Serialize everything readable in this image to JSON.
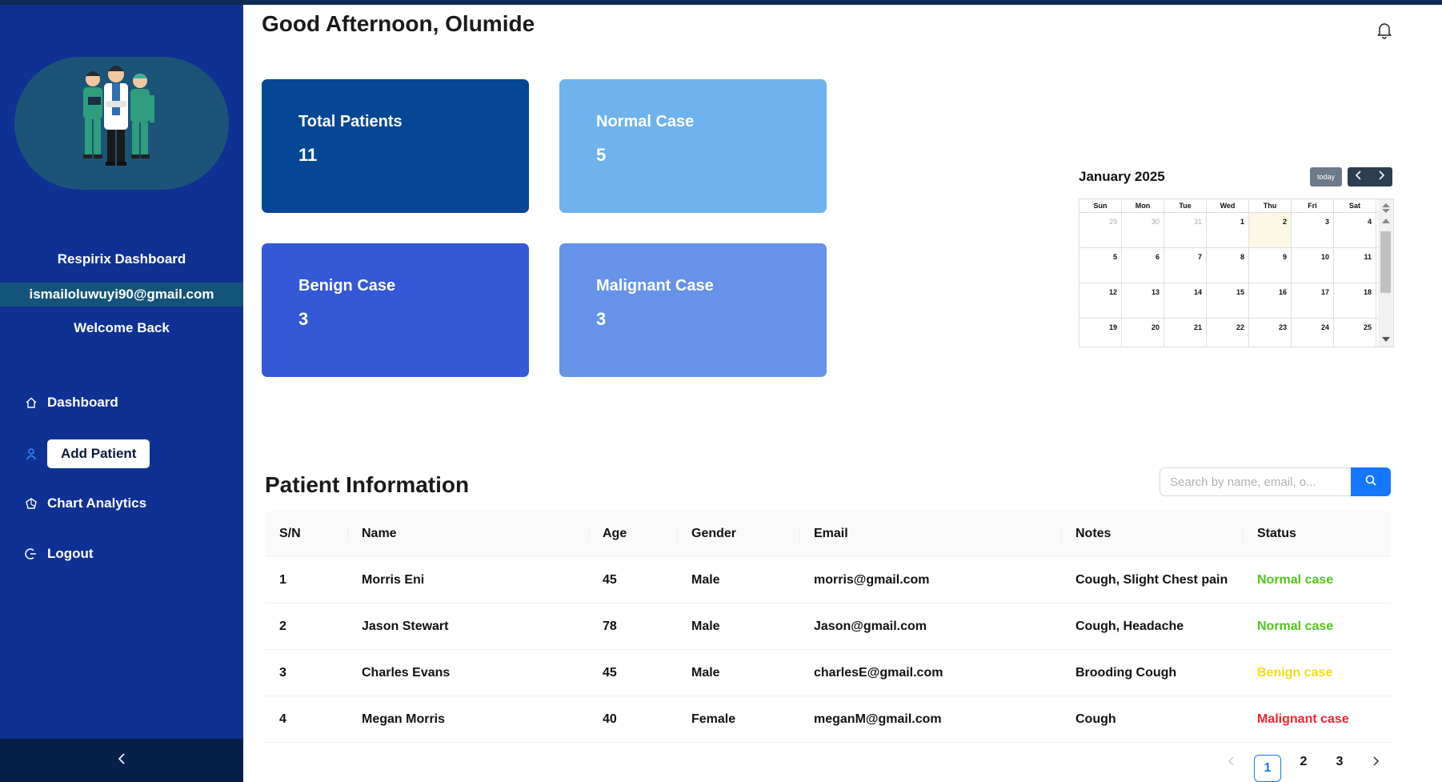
{
  "header": {
    "greeting": "Good Afternoon, Olumide"
  },
  "sidebar": {
    "app_name": "Respirix Dashboard",
    "email": "ismailoluwuyi90@gmail.com",
    "welcome": "Welcome Back",
    "nav": {
      "dashboard": "Dashboard",
      "add_patient": "Add Patient",
      "chart_analytics": "Chart Analytics",
      "logout": "Logout"
    }
  },
  "stats": {
    "total": {
      "label": "Total Patients",
      "value": "11"
    },
    "normal": {
      "label": "Normal Case",
      "value": "5"
    },
    "benign": {
      "label": "Benign Case",
      "value": "3"
    },
    "malignant": {
      "label": "Malignant Case",
      "value": "3"
    }
  },
  "calendar": {
    "title": "January 2025",
    "today_label": "today",
    "weekdays": [
      "Sun",
      "Mon",
      "Tue",
      "Wed",
      "Thu",
      "Fri",
      "Sat"
    ],
    "weeks": [
      [
        "29",
        "30",
        "31",
        "1",
        "2",
        "3",
        "4"
      ],
      [
        "5",
        "6",
        "7",
        "8",
        "9",
        "10",
        "11"
      ],
      [
        "12",
        "13",
        "14",
        "15",
        "16",
        "17",
        "18"
      ],
      [
        "19",
        "20",
        "21",
        "22",
        "23",
        "24",
        "25"
      ]
    ],
    "other_month_days": [
      "29",
      "30",
      "31"
    ],
    "today_day": "2"
  },
  "patients": {
    "title": "Patient Information",
    "search_placeholder": "Search by name, email, o...",
    "columns": [
      "S/N",
      "Name",
      "Age",
      "Gender",
      "Email",
      "Notes",
      "Status"
    ],
    "rows": [
      {
        "sn": "1",
        "name": "Morris Eni",
        "age": "45",
        "gender": "Male",
        "email": "morris@gmail.com",
        "notes": "Cough, Slight Chest pain",
        "status": "Normal case",
        "status_color": "#52c41a"
      },
      {
        "sn": "2",
        "name": "Jason Stewart",
        "age": "78",
        "gender": "Male",
        "email": "Jason@gmail.com",
        "notes": "Cough, Headache",
        "status": "Normal case",
        "status_color": "#52c41a"
      },
      {
        "sn": "3",
        "name": "Charles Evans",
        "age": "45",
        "gender": "Male",
        "email": "charlesE@gmail.com",
        "notes": "Brooding Cough",
        "status": "Benign case",
        "status_color": "#fadb14"
      },
      {
        "sn": "4",
        "name": "Megan Morris",
        "age": "40",
        "gender": "Female",
        "email": "meganM@gmail.com",
        "notes": "Cough",
        "status": "Malignant case",
        "status_color": "#f5222d"
      }
    ]
  },
  "pagination": {
    "pages": [
      "1",
      "2",
      "3"
    ],
    "current": "1"
  }
}
